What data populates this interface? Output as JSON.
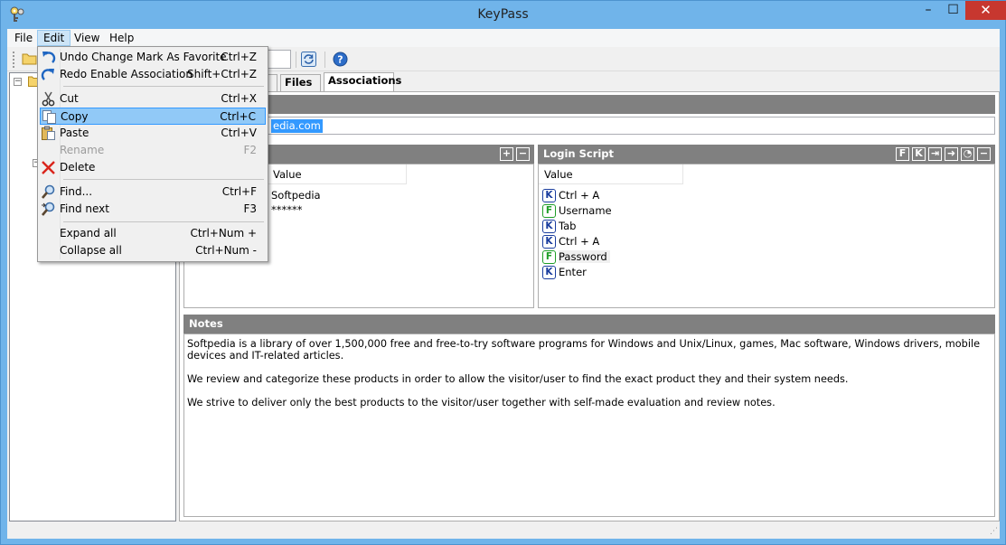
{
  "window": {
    "title": "KeyPass"
  },
  "menubar": {
    "file": "File",
    "edit": "Edit",
    "view": "View",
    "help": "Help"
  },
  "tabs": {
    "partial": "es",
    "files": "Files",
    "associations": "Associations"
  },
  "url_selected": "edia.com",
  "login_script": {
    "title": "Login Script",
    "column": "Value",
    "steps": [
      {
        "type": "K",
        "text": "Ctrl + A"
      },
      {
        "type": "F",
        "text": "Username"
      },
      {
        "type": "K",
        "text": "Tab"
      },
      {
        "type": "K",
        "text": "Ctrl + A"
      },
      {
        "type": "F",
        "text": "Password"
      },
      {
        "type": "K",
        "text": "Enter"
      }
    ],
    "buttons": [
      "F",
      "K",
      "⇥",
      "➜",
      "◔",
      "−"
    ]
  },
  "fields": {
    "column": "Value",
    "rows": [
      "Softpedia",
      "******"
    ],
    "buttons": [
      "+",
      "−"
    ]
  },
  "notes": {
    "title": "Notes",
    "paragraphs": [
      "Softpedia is a library of over 1,500,000 free and free-to-try software programs for Windows and Unix/Linux, games, Mac software, Windows drivers, mobile devices and IT-related articles.",
      "We review and categorize these products in order to allow the visitor/user to find the exact product they and their system needs.",
      "We strive to deliver only the best products to the visitor/user together with self-made evaluation and review notes."
    ]
  },
  "edit_menu": [
    {
      "label": "Undo Change Mark As Favorite",
      "shortcut": "Ctrl+Z",
      "icon": "undo-icon"
    },
    {
      "label": "Redo Enable Association",
      "shortcut": "Shift+Ctrl+Z",
      "icon": "redo-icon"
    },
    {
      "label": "Cut",
      "shortcut": "Ctrl+X",
      "icon": "scissors-icon"
    },
    {
      "label": "Copy",
      "shortcut": "Ctrl+C",
      "icon": "copy-icon"
    },
    {
      "label": "Paste",
      "shortcut": "Ctrl+V",
      "icon": "paste-icon"
    },
    {
      "label": "Rename",
      "shortcut": "F2",
      "icon": ""
    },
    {
      "label": "Delete",
      "shortcut": "",
      "icon": "delete-icon"
    },
    {
      "label": "Find...",
      "shortcut": "Ctrl+F",
      "icon": "find-icon"
    },
    {
      "label": "Find next",
      "shortcut": "F3",
      "icon": "find-next-icon"
    },
    {
      "label": "Expand all",
      "shortcut": "Ctrl+Num +",
      "icon": ""
    },
    {
      "label": "Collapse all",
      "shortcut": "Ctrl+Num -",
      "icon": ""
    }
  ],
  "colors": {
    "accent": "#3399ff",
    "menu_highlight": "#91c9f7",
    "section_header": "#808080",
    "close_button": "#c7372f",
    "keystroke_badge": "#1a3d9e",
    "field_badge": "#1e9e27"
  }
}
